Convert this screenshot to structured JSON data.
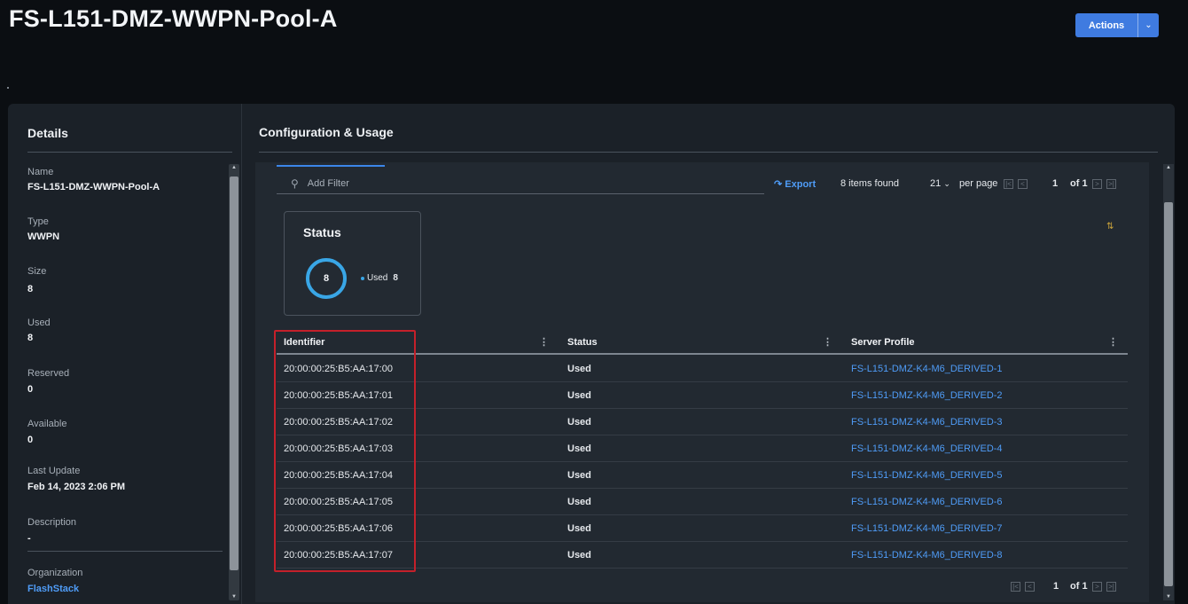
{
  "header": {
    "title": "FS-L151-DMZ-WWPN-Pool-A",
    "actions_label": "Actions",
    "actions_caret": "⌄"
  },
  "details": {
    "title": "Details",
    "fields": [
      {
        "label": "Name",
        "value": "FS-L151-DMZ-WWPN-Pool-A"
      },
      {
        "label": "Type",
        "value": "WWPN"
      },
      {
        "label": "Size",
        "value": "8"
      },
      {
        "label": "Used",
        "value": "8"
      },
      {
        "label": "Reserved",
        "value": "0"
      },
      {
        "label": "Available",
        "value": "0"
      },
      {
        "label": "Last Update",
        "value": "Feb 14, 2023 2:06 PM"
      },
      {
        "label": "Description",
        "value": "-"
      },
      {
        "label": "Organization",
        "value": "FlashStack"
      }
    ]
  },
  "config": {
    "title": "Configuration & Usage",
    "filter_placeholder": "Add Filter",
    "export_label": "Export",
    "items_found": "8 items found",
    "per_page_value": "21",
    "per_page_label": "per page",
    "page_number": "1",
    "page_of": "of 1",
    "status_card": {
      "title": "Status",
      "donut_value": "8",
      "legend_label": "Used",
      "legend_value": "8"
    },
    "table": {
      "columns": [
        "Identifier",
        "Status",
        "Server Profile"
      ],
      "rows": [
        {
          "identifier": "20:00:00:25:B5:AA:17:00",
          "status": "Used",
          "profile": "FS-L151-DMZ-K4-M6_DERIVED-1"
        },
        {
          "identifier": "20:00:00:25:B5:AA:17:01",
          "status": "Used",
          "profile": "FS-L151-DMZ-K4-M6_DERIVED-2"
        },
        {
          "identifier": "20:00:00:25:B5:AA:17:02",
          "status": "Used",
          "profile": "FS-L151-DMZ-K4-M6_DERIVED-3"
        },
        {
          "identifier": "20:00:00:25:B5:AA:17:03",
          "status": "Used",
          "profile": "FS-L151-DMZ-K4-M6_DERIVED-4"
        },
        {
          "identifier": "20:00:00:25:B5:AA:17:04",
          "status": "Used",
          "profile": "FS-L151-DMZ-K4-M6_DERIVED-5"
        },
        {
          "identifier": "20:00:00:25:B5:AA:17:05",
          "status": "Used",
          "profile": "FS-L151-DMZ-K4-M6_DERIVED-6"
        },
        {
          "identifier": "20:00:00:25:B5:AA:17:06",
          "status": "Used",
          "profile": "FS-L151-DMZ-K4-M6_DERIVED-7"
        },
        {
          "identifier": "20:00:00:25:B5:AA:17:07",
          "status": "Used",
          "profile": "FS-L151-DMZ-K4-M6_DERIVED-8"
        }
      ]
    }
  },
  "colors": {
    "accent": "#3f7be0",
    "link": "#4f9cf7",
    "donut": "#39a6e6",
    "highlight_box": "#c4202a"
  },
  "icons": [
    "search-icon",
    "export-icon",
    "chevron-down-icon",
    "first-page-icon",
    "prev-page-icon",
    "next-page-icon",
    "last-page-icon",
    "sort-icon",
    "collapse-icon"
  ]
}
